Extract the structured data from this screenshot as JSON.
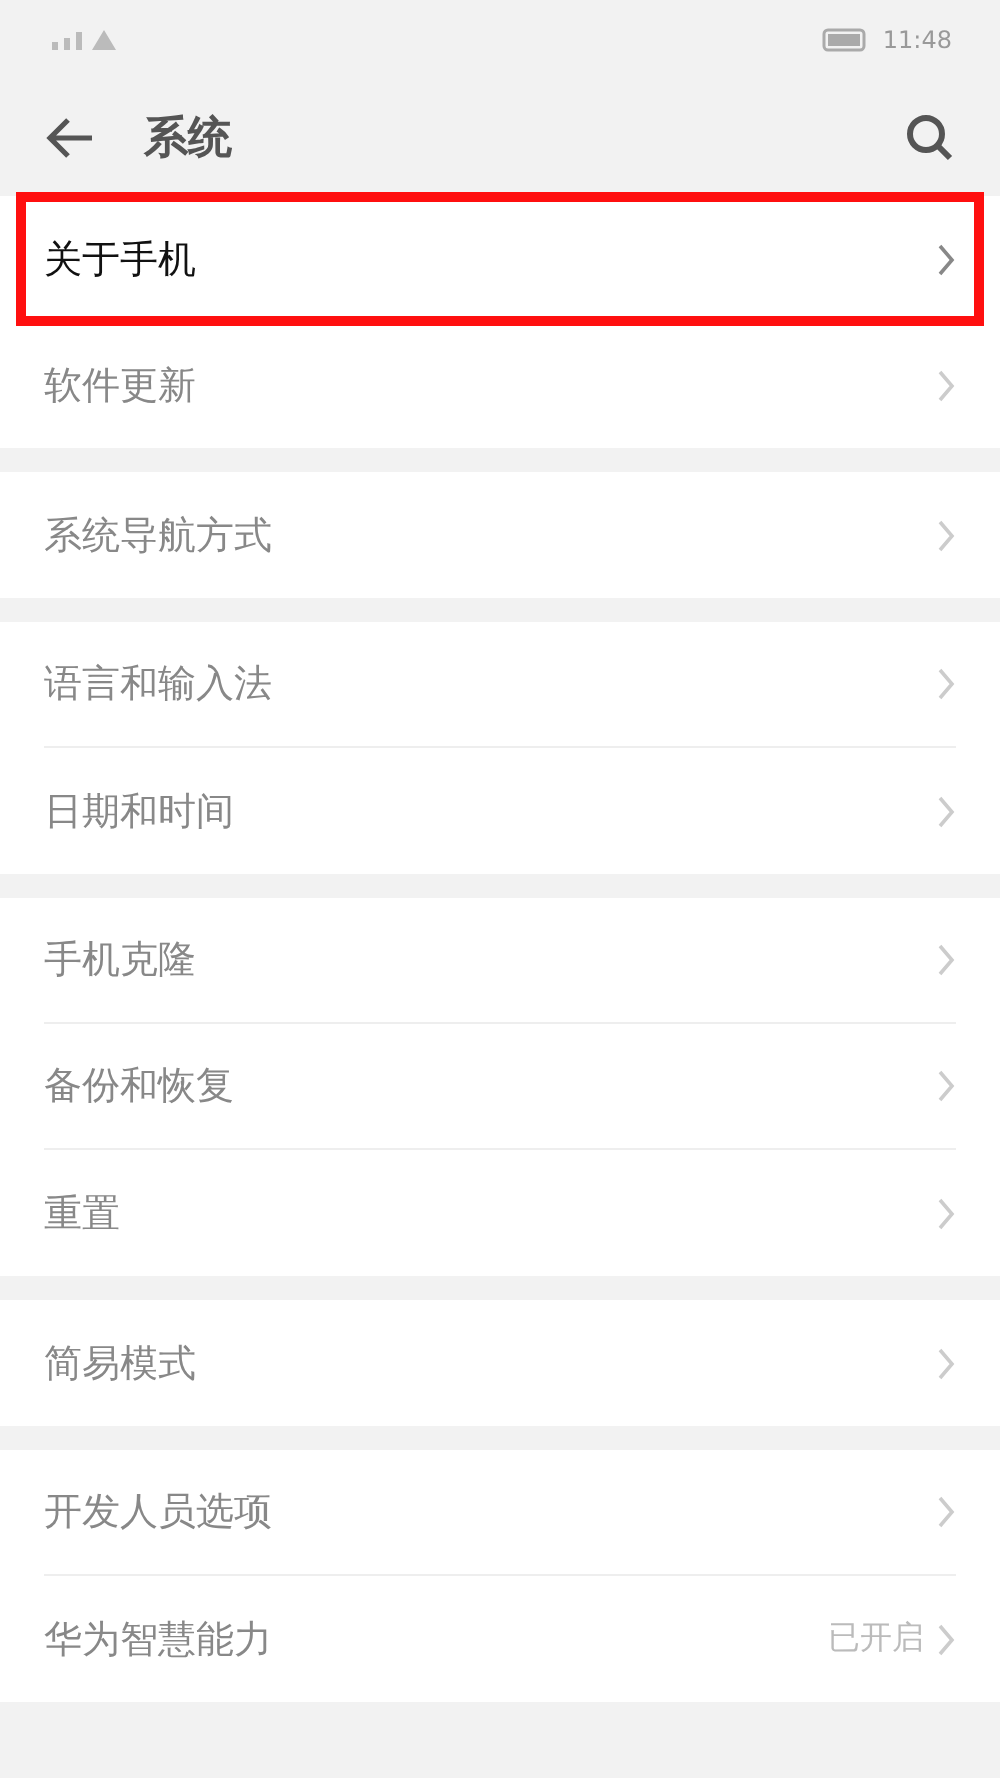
{
  "status_bar": {
    "time": "11:48"
  },
  "header": {
    "title": "系统"
  },
  "groups": [
    {
      "items": [
        {
          "label": "关于手机",
          "highlighted": true
        },
        {
          "label": "软件更新",
          "highlighted": false
        }
      ]
    },
    {
      "items": [
        {
          "label": "系统导航方式",
          "highlighted": false
        }
      ]
    },
    {
      "items": [
        {
          "label": "语言和输入法",
          "highlighted": false
        },
        {
          "label": "日期和时间",
          "highlighted": false
        }
      ]
    },
    {
      "items": [
        {
          "label": "手机克隆",
          "highlighted": false
        },
        {
          "label": "备份和恢复",
          "highlighted": false
        },
        {
          "label": "重置",
          "highlighted": false
        }
      ]
    },
    {
      "items": [
        {
          "label": "简易模式",
          "highlighted": false
        }
      ]
    },
    {
      "items": [
        {
          "label": "开发人员选项",
          "highlighted": false
        },
        {
          "label": "华为智慧能力",
          "value": "已开启",
          "highlighted": false
        }
      ]
    }
  ]
}
